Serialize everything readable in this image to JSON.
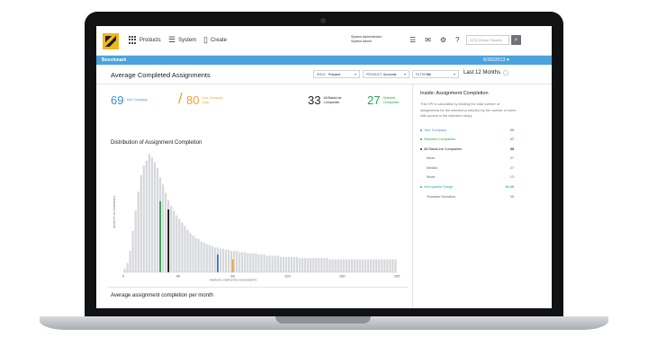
{
  "nav": {
    "products_label": "Products",
    "system_label": "System",
    "create_label": "Create",
    "user_line1": "System Administrator",
    "user_line2": "System Admin",
    "search_placeholder": "IQ7Q (Global / Search)"
  },
  "bluebar": {
    "title": "Benchmark",
    "date": "6/30/2013 ▾"
  },
  "header": {
    "page_title": "Average Completed Assignments",
    "filters": [
      {
        "label": "ROLE:",
        "value": "Preparer"
      },
      {
        "label": "PRODUCT:",
        "value": "Accounts"
      },
      {
        "label": "FILTERS:",
        "value": "All"
      }
    ],
    "period": "Last 12 Months"
  },
  "kpis": [
    {
      "value": "69",
      "label": "Your Company",
      "color": "#3a8fd0"
    },
    {
      "value": "80",
      "label": "Your Company Goal",
      "color": "#f0a030"
    },
    {
      "value": "33",
      "label": "All BlackLine Companies",
      "color": "#222222"
    },
    {
      "value": "27",
      "label": "Selected Companies",
      "color": "#2aa34a"
    }
  ],
  "chart_title": "Distribution of Assignment Completion",
  "chart_data": {
    "type": "bar",
    "title": "Distribution of Assignment Completion",
    "xlabel": "AVERAGE COMPLETED ASSIGNMENTS",
    "ylabel": "QUANTITY OF COMPANIES",
    "xlim": [
      0,
      200
    ],
    "x_ticks": [
      "0",
      "40",
      "80",
      "120",
      "160",
      "200"
    ],
    "grid": false,
    "bin_width": 2,
    "values": [
      3,
      8,
      18,
      35,
      52,
      68,
      82,
      90,
      94,
      100,
      97,
      93,
      88,
      80,
      74,
      67,
      61,
      56,
      52,
      48,
      45,
      42,
      39,
      36,
      33,
      31,
      29,
      28,
      26,
      25,
      24,
      23,
      22,
      21,
      21,
      20,
      20,
      19,
      19,
      18,
      18,
      18,
      17,
      17,
      17,
      16,
      16,
      16,
      16,
      15,
      15,
      15,
      14,
      14,
      14,
      14,
      14,
      13,
      13,
      13,
      13,
      13,
      13,
      13,
      12,
      12,
      12,
      12,
      12,
      12,
      12,
      12,
      12,
      12,
      12,
      11,
      11,
      11,
      11,
      11,
      11,
      11,
      11,
      11,
      11,
      11,
      11,
      11,
      11,
      11,
      11,
      11,
      11,
      11,
      11,
      11,
      11,
      11,
      11,
      11
    ],
    "markers": [
      {
        "name": "Selected Companies",
        "x": 27,
        "color": "#2aa34a",
        "height": 60
      },
      {
        "name": "All BlackLine Companies",
        "x": 33,
        "color": "#111111",
        "height": 53
      },
      {
        "name": "Your Company",
        "x": 69,
        "color": "#2f74c0",
        "height": 15
      },
      {
        "name": "Your Company Goal",
        "x": 80,
        "color": "#f0a030",
        "height": 11
      }
    ]
  },
  "chart2_title": "Average assignment completion per month",
  "sidebar": {
    "title": "Inside: Assignment Completion",
    "description": "This KPI is calculated by dividing the total number of assignments for the selected product(s) by the number of users with access to the selected role(s).",
    "stats": [
      {
        "label": "Your Company",
        "value": "69",
        "color": "#3a8fd0",
        "indent": false
      },
      {
        "label": "Selected Companies",
        "value": "27",
        "color": "#2aa34a",
        "indent": false
      },
      {
        "label": "All BlackLine Companies",
        "value": "33",
        "color": "#222222",
        "indent": false
      },
      {
        "label": "Mean",
        "value": "37",
        "color": "#666666",
        "indent": true
      },
      {
        "label": "Median",
        "value": "27",
        "color": "#666666",
        "indent": true
      },
      {
        "label": "Mode",
        "value": "13",
        "color": "#666666",
        "indent": true
      },
      {
        "label": "Interquartile Range",
        "value": "19-40",
        "color": "#2ab0a4",
        "indent": false
      },
      {
        "label": "Standard Deviation",
        "value": "35",
        "color": "#666666",
        "indent": true
      }
    ]
  }
}
